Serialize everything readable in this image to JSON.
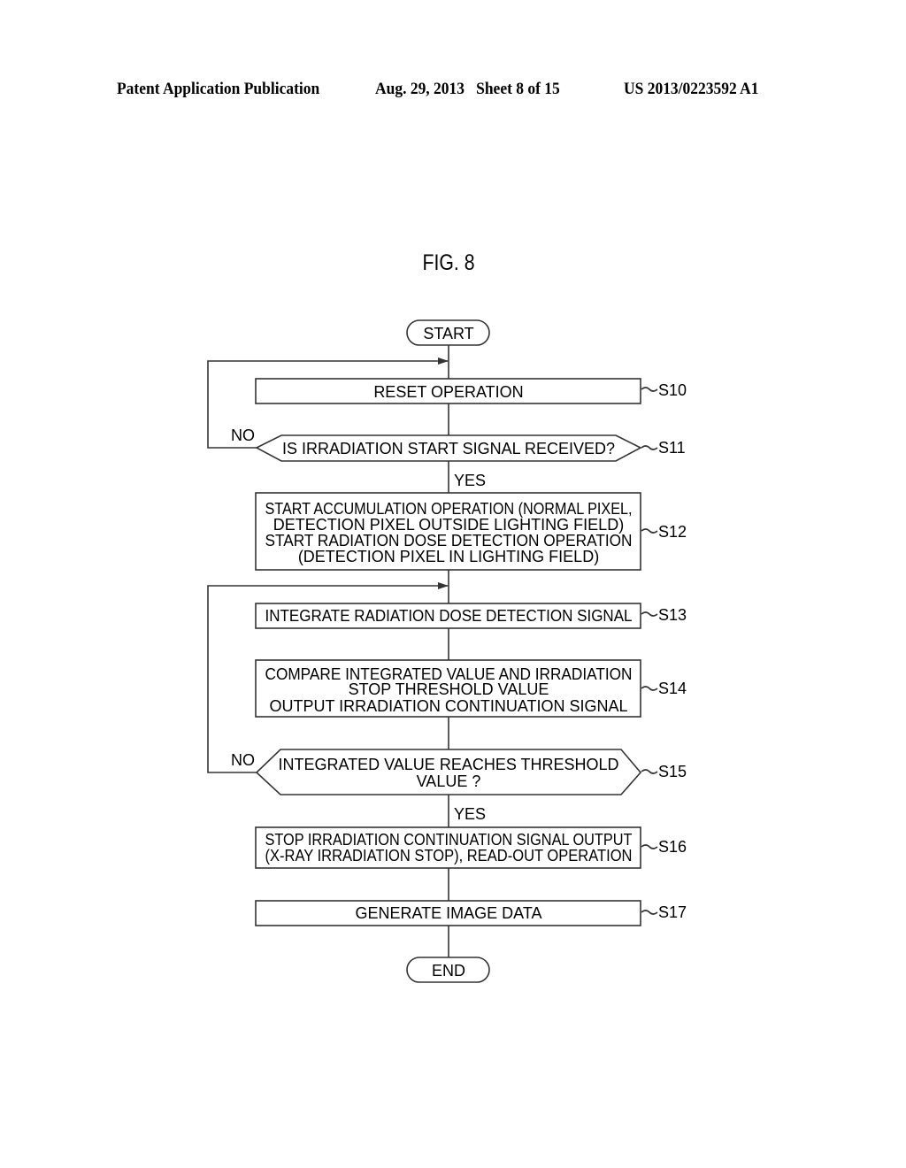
{
  "header": {
    "publication": "Patent Application Publication",
    "date_sheet": "Aug. 29, 2013   Sheet 8 of 15",
    "patent_number": "US 2013/0223592 A1"
  },
  "figure": {
    "title": "FIG. 8",
    "start_label": "START",
    "end_label": "END",
    "steps": [
      {
        "id": "S10",
        "type": "process",
        "lines": [
          "RESET OPERATION"
        ]
      },
      {
        "id": "S11",
        "type": "decision",
        "lines": [
          "IS IRRADIATION START SIGNAL RECEIVED?"
        ],
        "no_label": "NO",
        "yes_label": "YES"
      },
      {
        "id": "S12",
        "type": "process",
        "lines": [
          "START ACCUMULATION OPERATION (NORMAL PIXEL,",
          "DETECTION PIXEL OUTSIDE LIGHTING FIELD)",
          "START RADIATION DOSE DETECTION OPERATION",
          "(DETECTION PIXEL IN LIGHTING FIELD)"
        ]
      },
      {
        "id": "S13",
        "type": "process",
        "lines": [
          "INTEGRATE RADIATION DOSE DETECTION SIGNAL"
        ]
      },
      {
        "id": "S14",
        "type": "process",
        "lines": [
          "COMPARE INTEGRATED VALUE AND IRRADIATION",
          "STOP THRESHOLD VALUE",
          "OUTPUT IRRADIATION CONTINUATION SIGNAL"
        ]
      },
      {
        "id": "S15",
        "type": "decision",
        "lines": [
          "INTEGRATED VALUE REACHES THRESHOLD",
          "VALUE ?"
        ],
        "no_label": "NO",
        "yes_label": "YES"
      },
      {
        "id": "S16",
        "type": "process",
        "lines": [
          "STOP IRRADIATION CONTINUATION SIGNAL OUTPUT",
          "(X-RAY IRRADIATION STOP), READ-OUT OPERATION"
        ]
      },
      {
        "id": "S17",
        "type": "process",
        "lines": [
          "GENERATE IMAGE DATA"
        ]
      }
    ]
  }
}
